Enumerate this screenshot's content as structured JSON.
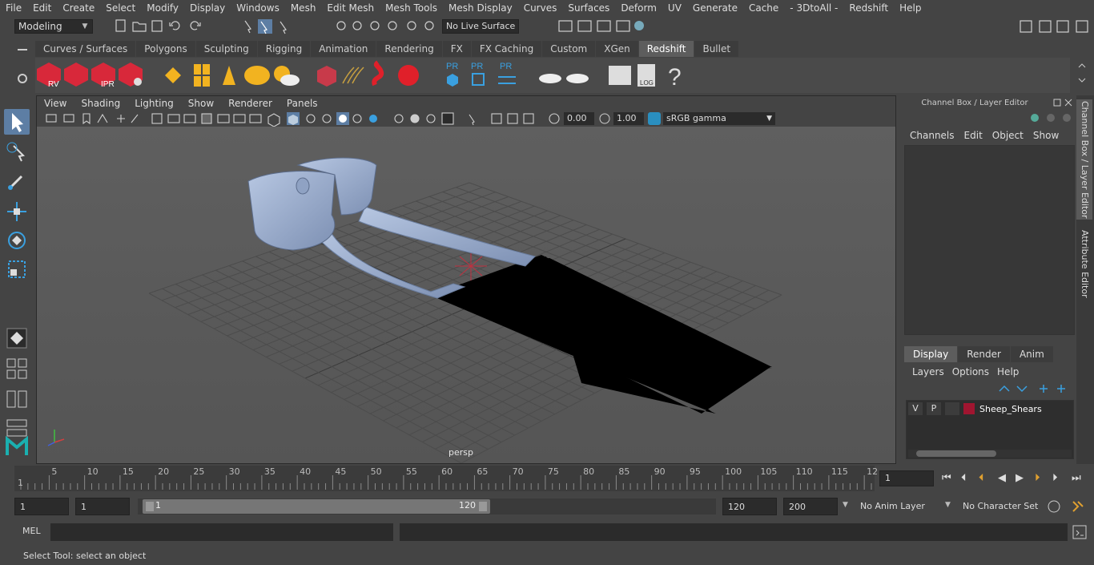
{
  "menubar": [
    "File",
    "Edit",
    "Create",
    "Select",
    "Modify",
    "Display",
    "Windows",
    "Mesh",
    "Edit Mesh",
    "Mesh Tools",
    "Mesh Display",
    "Curves",
    "Surfaces",
    "Deform",
    "UV",
    "Generate",
    "Cache",
    "- 3DtoAll -",
    "Redshift",
    "Help"
  ],
  "status": {
    "mode": "Modeling",
    "live_surface": "No Live Surface"
  },
  "shelf_tabs": [
    "Curves / Surfaces",
    "Polygons",
    "Sculpting",
    "Rigging",
    "Animation",
    "Rendering",
    "FX",
    "FX Caching",
    "Custom",
    "XGen",
    "Redshift",
    "Bullet"
  ],
  "shelf_active": "Redshift",
  "shelf_labels": {
    "rv": "RV",
    "ipr": "IPR",
    "pr": "PR",
    "log": "LOG",
    "help": "?"
  },
  "viewport": {
    "menu": [
      "View",
      "Shading",
      "Lighting",
      "Show",
      "Renderer",
      "Panels"
    ],
    "exposure": "0.00",
    "gamma": "1.00",
    "color_space": "sRGB gamma",
    "camera": "persp"
  },
  "right_panel": {
    "title": "Channel Box / Layer Editor",
    "menu": [
      "Channels",
      "Edit",
      "Object",
      "Show"
    ],
    "layer_tabs": [
      "Display",
      "Render",
      "Anim"
    ],
    "layer_active": "Display",
    "layer_menu": [
      "Layers",
      "Options",
      "Help"
    ],
    "layer": {
      "v": "V",
      "p": "P",
      "name": "Sheep_Shears"
    },
    "side_tabs": [
      "Channel Box / Layer Editor",
      "Attribute Editor"
    ]
  },
  "timeline": {
    "ticks": [
      "5",
      "10",
      "15",
      "20",
      "25",
      "30",
      "35",
      "40",
      "45",
      "50",
      "55",
      "60",
      "65",
      "70",
      "75",
      "80",
      "85",
      "90",
      "95",
      "100",
      "105",
      "110",
      "115",
      "12"
    ],
    "first": "1",
    "current_frame": "1"
  },
  "range": {
    "start": "1",
    "start2": "1",
    "range_start": "1",
    "range_end": "120",
    "end": "120",
    "total": "200",
    "anim_layer": "No Anim Layer",
    "character_set": "No Character Set"
  },
  "command": {
    "lang": "MEL"
  },
  "help_line": "Select Tool: select an object"
}
